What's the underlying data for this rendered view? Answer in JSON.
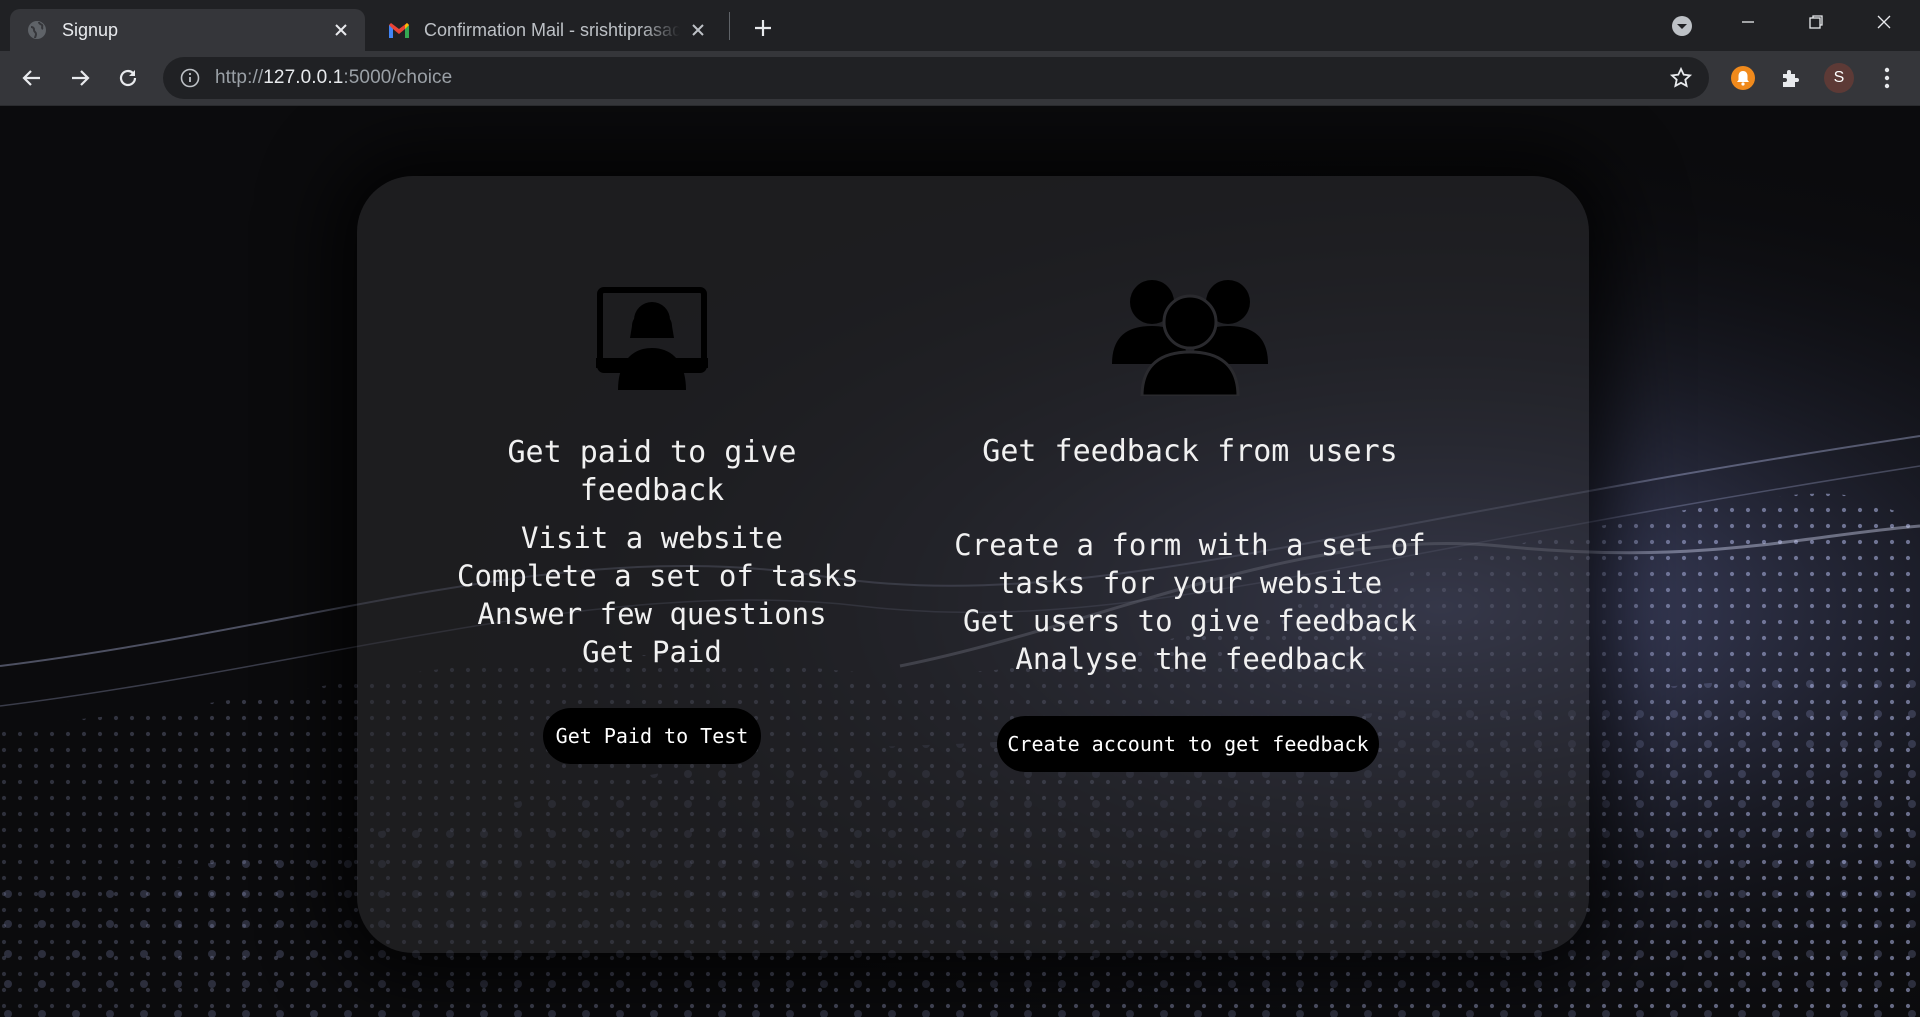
{
  "browser": {
    "tabs": [
      {
        "title": "Signup",
        "active": true
      },
      {
        "title": "Confirmation Mail - srishtiprasad",
        "active": false
      }
    ],
    "url_scheme": "http://",
    "url_host": "127.0.0.1",
    "url_rest": ":5000/choice",
    "profile_initial": "S"
  },
  "choices": {
    "tester": {
      "icon": "person-monitor-icon",
      "heading": "Get paid to give feedback",
      "steps": [
        "Visit a website",
        "Complete a set of tasks",
        "Answer few questions",
        "Get Paid"
      ],
      "button": "Get Paid to Test"
    },
    "owner": {
      "icon": "user-group-icon",
      "heading": "Get feedback from users",
      "steps": [
        "Create a form with a set of",
        "tasks for your website",
        "Get users to give feedback",
        "Analyse the feedback"
      ],
      "button": "Create account to get feedback"
    }
  },
  "colors": {
    "chrome_dark": "#202124",
    "chrome_tab": "#35363a",
    "card": "#2a2a2e",
    "button": "#000000",
    "wave": "#aab4ff"
  }
}
